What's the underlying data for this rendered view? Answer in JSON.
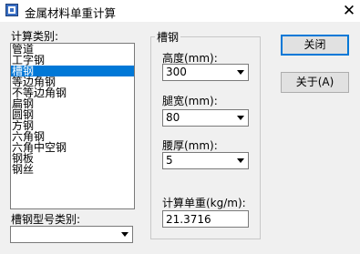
{
  "window": {
    "title": "金属材料单重计算"
  },
  "left": {
    "category_label": "计算类别:",
    "categories": [
      {
        "label": "管道",
        "selected": false
      },
      {
        "label": "工字钢",
        "selected": false
      },
      {
        "label": "槽钢",
        "selected": true
      },
      {
        "label": "等边角钢",
        "selected": false
      },
      {
        "label": "不等边角钢",
        "selected": false
      },
      {
        "label": "扁钢",
        "selected": false
      },
      {
        "label": "圆钢",
        "selected": false
      },
      {
        "label": "方钢",
        "selected": false
      },
      {
        "label": "六角钢",
        "selected": false
      },
      {
        "label": "六角中空钢",
        "selected": false
      },
      {
        "label": "钢板",
        "selected": false
      },
      {
        "label": "钢丝",
        "selected": false
      }
    ],
    "model_type_label": "槽钢型号类别:",
    "model_type_value": ""
  },
  "group": {
    "title": "槽钢",
    "height_label": "高度(mm):",
    "height_value": "300",
    "leg_width_label": "腿宽(mm):",
    "leg_width_value": "80",
    "waist_thickness_label": "腰厚(mm):",
    "waist_thickness_value": "5",
    "unit_weight_label": "计算单重(kg/m):",
    "unit_weight_value": "21.3716"
  },
  "buttons": {
    "close": "关闭",
    "about": "关于(A)"
  },
  "colors": {
    "selection": "#0078d7",
    "default_button_border": "#0078d7"
  },
  "icons": [
    "app-icon",
    "close-icon",
    "dropdown-arrow-icon"
  ]
}
